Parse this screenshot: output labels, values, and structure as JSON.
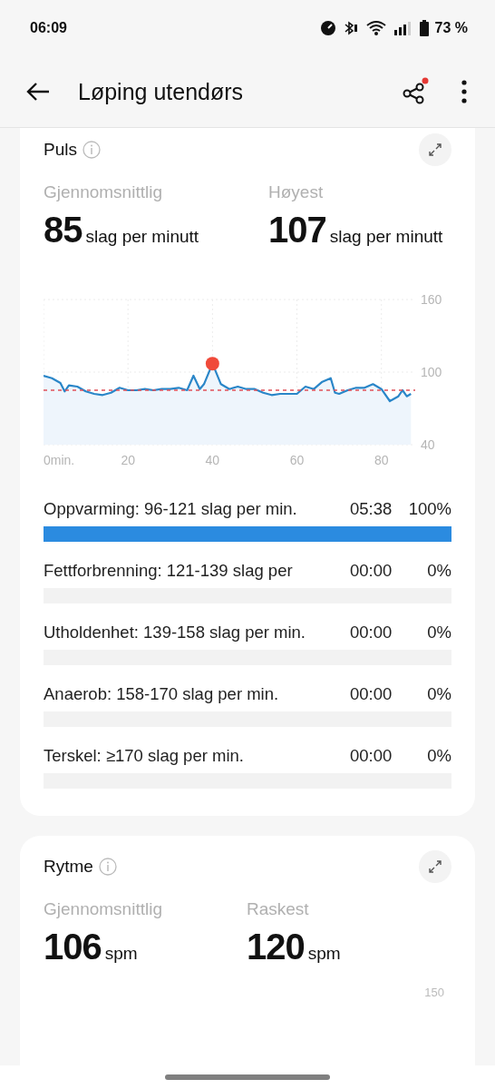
{
  "status_bar": {
    "time": "06:09",
    "battery": "73 %"
  },
  "app_bar": {
    "title": "Løping utendørs",
    "share_notification": true
  },
  "heart_card": {
    "title": "Puls",
    "stats": [
      {
        "label": "Gjennomsnittlig",
        "value": "85",
        "unit": "slag per minutt"
      },
      {
        "label": "Høyest",
        "value": "107",
        "unit": "slag per minutt"
      }
    ],
    "chart_data": {
      "type": "line",
      "x": [
        0,
        2,
        4,
        5,
        6,
        8,
        10,
        12,
        14,
        16,
        18,
        20,
        22,
        24,
        26,
        28,
        30,
        32,
        34,
        35.5,
        37,
        38,
        40,
        42,
        44,
        46,
        48,
        50,
        52,
        54,
        56,
        58,
        60,
        62,
        64,
        66,
        68,
        69,
        70,
        72,
        74,
        76,
        78,
        80,
        82,
        84,
        85,
        86,
        87
      ],
      "values": [
        97,
        95,
        91,
        84,
        89,
        88,
        84,
        82,
        81,
        83,
        87,
        85,
        85,
        86,
        85,
        86,
        86,
        87,
        85,
        97,
        86,
        90,
        107,
        90,
        86,
        88,
        86,
        86,
        83,
        81,
        82,
        82,
        82,
        88,
        86,
        92,
        95,
        83,
        82,
        85,
        87,
        87,
        90,
        86,
        76,
        80,
        85,
        80,
        82
      ],
      "xlim": [
        0,
        88
      ],
      "ylim": [
        40,
        160
      ],
      "yticks": [
        40,
        100,
        160
      ],
      "xticks": [
        {
          "value": 0,
          "label": "0min."
        },
        20,
        40,
        60,
        80
      ],
      "grid": "both",
      "ref_lines": [
        {
          "axis": "y",
          "value": 85
        }
      ]
    },
    "zones": [
      {
        "label": "Oppvarming: 96-121 slag per min.",
        "time": "05:38",
        "percent": "100%",
        "level": 1
      },
      {
        "label": "Fettforbrenning: 121-139 slag per",
        "time": "00:00",
        "percent": "0%",
        "level": 0
      },
      {
        "label": "Utholdenhet: 139-158 slag per min.",
        "time": "00:00",
        "percent": "0%",
        "level": 0
      },
      {
        "label": "Anaerob: 158-170 slag per min.",
        "time": "00:00",
        "percent": "0%",
        "level": 0
      },
      {
        "label": "Terskel: ≥170 slag per min.",
        "time": "00:00",
        "percent": "0%",
        "level": 0
      }
    ]
  },
  "cadence_card": {
    "title": "Rytme",
    "stats": [
      {
        "label": "Gjennomsnittlig",
        "value": "106",
        "unit": "spm"
      },
      {
        "label": "Raskest",
        "value": "120",
        "unit": "spm"
      }
    ],
    "partial_tick": "150"
  }
}
